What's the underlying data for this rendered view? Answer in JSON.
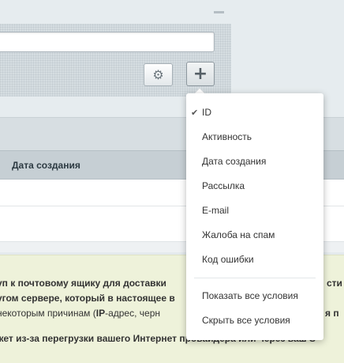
{
  "filter": {
    "search_value": "",
    "settings_icon": "gear-icon",
    "add_icon": "plus-icon",
    "settings_glyph": "⚙",
    "add_glyph": "+"
  },
  "grid": {
    "column_header": "Дата создания"
  },
  "dropdown": {
    "checkmark": "✔",
    "items": [
      {
        "label": "ID",
        "checked": true
      },
      {
        "label": "Активность",
        "checked": false
      },
      {
        "label": "Дата создания",
        "checked": false
      },
      {
        "label": "Рассылка",
        "checked": false
      },
      {
        "label": "E-mail",
        "checked": false
      },
      {
        "label": "Жалоба на спам",
        "checked": false
      },
      {
        "label": "Код ошибки",
        "checked": false
      }
    ],
    "actions": [
      {
        "label": "Показать все условия"
      },
      {
        "label": "Скрыть все условия"
      }
    ]
  },
  "message": {
    "line1": "уп к почтовому ящику для доставки",
    "line1_tail": "сти",
    "line2": "угом сервере, который в настоящее в",
    "line3_a": "некоторым причинам (",
    "line3_b": "IP",
    "line3_c": "-адрес, черн",
    "line3_tail": "я п",
    "line4": "жет из-за перегрузки вашего Интернет провайдера или через ваш S"
  }
}
